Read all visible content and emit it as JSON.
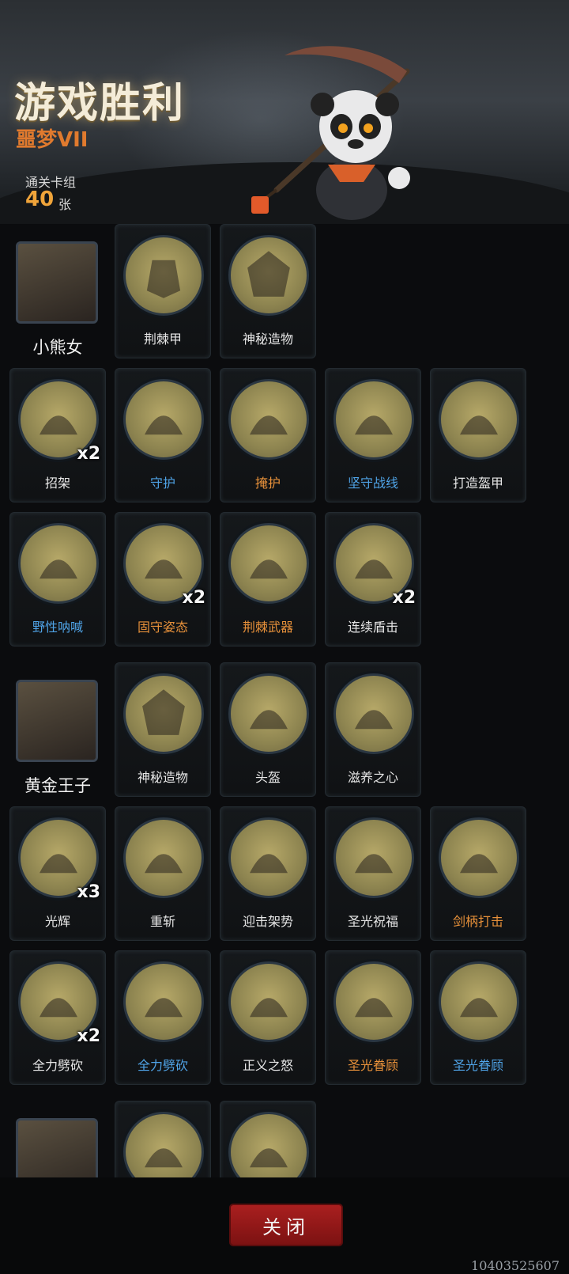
{
  "header": {
    "title": "游戏胜利",
    "difficulty": "噩梦VII",
    "deck_label": "通关卡组",
    "deck_count": "40",
    "deck_unit": "张"
  },
  "characters": [
    {
      "name": "小熊女",
      "icon": "bear-girl-portrait",
      "rows": [
        [
          {
            "name": "荆棘甲",
            "color": "white",
            "icon": "hooded-armor-icon"
          },
          {
            "name": "神秘造物",
            "color": "white",
            "icon": "mystic-artifact-icon"
          }
        ],
        [
          {
            "name": "招架",
            "color": "white",
            "mult": "x2",
            "icon": "axe-shield-icon"
          },
          {
            "name": "守护",
            "color": "blue",
            "icon": "bear-shield-icon"
          },
          {
            "name": "掩护",
            "color": "orange",
            "icon": "bear-cover-icon"
          },
          {
            "name": "坚守战线",
            "color": "blue",
            "icon": "spiked-shield-icon"
          },
          {
            "name": "打造盔甲",
            "color": "white",
            "icon": "forge-armor-icon"
          }
        ],
        [
          {
            "name": "野性呐喊",
            "color": "blue",
            "icon": "wild-roar-icon"
          },
          {
            "name": "固守姿态",
            "color": "orange",
            "mult": "x2",
            "icon": "double-shield-icon"
          },
          {
            "name": "荆棘武器",
            "color": "orange",
            "icon": "thorn-weapon-icon"
          },
          {
            "name": "连续盾击",
            "color": "white",
            "mult": "x2",
            "icon": "shield-bash-icon"
          }
        ]
      ]
    },
    {
      "name": "黄金王子",
      "icon": "golden-prince-portrait",
      "rows": [
        [
          {
            "name": "神秘造物",
            "color": "white",
            "icon": "mystic-artifact-icon"
          },
          {
            "name": "头盔",
            "color": "white",
            "icon": "bear-helmet-icon"
          },
          {
            "name": "滋养之心",
            "color": "white",
            "icon": "nurturing-heart-icon"
          }
        ],
        [
          {
            "name": "光辉",
            "color": "white",
            "mult": "x3",
            "icon": "radiance-icon"
          },
          {
            "name": "重斩",
            "color": "white",
            "icon": "heavy-slash-icon"
          },
          {
            "name": "迎击架势",
            "color": "white",
            "icon": "counter-stance-icon"
          },
          {
            "name": "圣光祝福",
            "color": "white",
            "icon": "knight-blessing-icon"
          },
          {
            "name": "剑柄打击",
            "color": "orange",
            "icon": "hilt-strike-icon"
          }
        ],
        [
          {
            "name": "全力劈砍",
            "color": "white",
            "mult": "x2",
            "icon": "full-cleave-icon"
          },
          {
            "name": "全力劈砍",
            "color": "blue",
            "icon": "full-cleave-icon"
          },
          {
            "name": "正义之怒",
            "color": "white",
            "icon": "righteous-fury-icon"
          },
          {
            "name": "圣光眷顾",
            "color": "orange",
            "icon": "holy-favor-icon"
          },
          {
            "name": "圣光眷顾",
            "color": "blue",
            "icon": "holy-favor-icon"
          }
        ]
      ]
    },
    {
      "name": "",
      "icon": "pink-hair-portrait",
      "rows": [
        [
          {
            "name": "",
            "color": "white",
            "icon": "purple-artifact-icon"
          },
          {
            "name": "",
            "color": "white",
            "icon": "blue-swirl-icon"
          }
        ]
      ]
    }
  ],
  "footer": {
    "close_label": "关闭",
    "id_text": "10403525607"
  },
  "colors": {
    "white": "#e6e6e6",
    "blue": "#4fa3e6",
    "orange": "#e8913a",
    "accent_red": "#a91f1f",
    "title_gold": "#f4ecd8",
    "difficulty_orange": "#e07a2e"
  }
}
